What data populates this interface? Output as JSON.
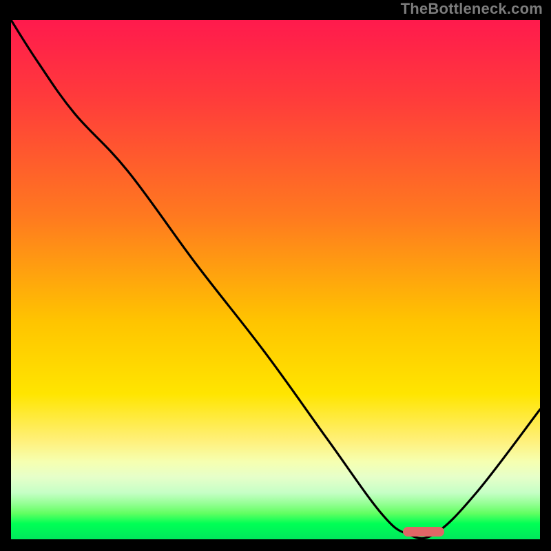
{
  "attribution": "TheBottleneck.com",
  "chart_data": {
    "type": "line",
    "title": "",
    "xlabel": "",
    "ylabel": "",
    "xlim": [
      0,
      100
    ],
    "ylim": [
      0,
      100
    ],
    "series": [
      {
        "name": "curve",
        "x": [
          0,
          5,
          12,
          22,
          35,
          48,
          60,
          70,
          75,
          80,
          88,
          100
        ],
        "y": [
          100,
          92,
          82,
          71,
          53,
          36,
          19,
          5,
          1,
          1,
          9,
          25
        ]
      }
    ],
    "optimum_marker": {
      "x": 78,
      "y": 1.5
    },
    "gradient": {
      "top": "#ff1a4d",
      "mid": "#ffe500",
      "bottom": "#00e85c"
    }
  }
}
